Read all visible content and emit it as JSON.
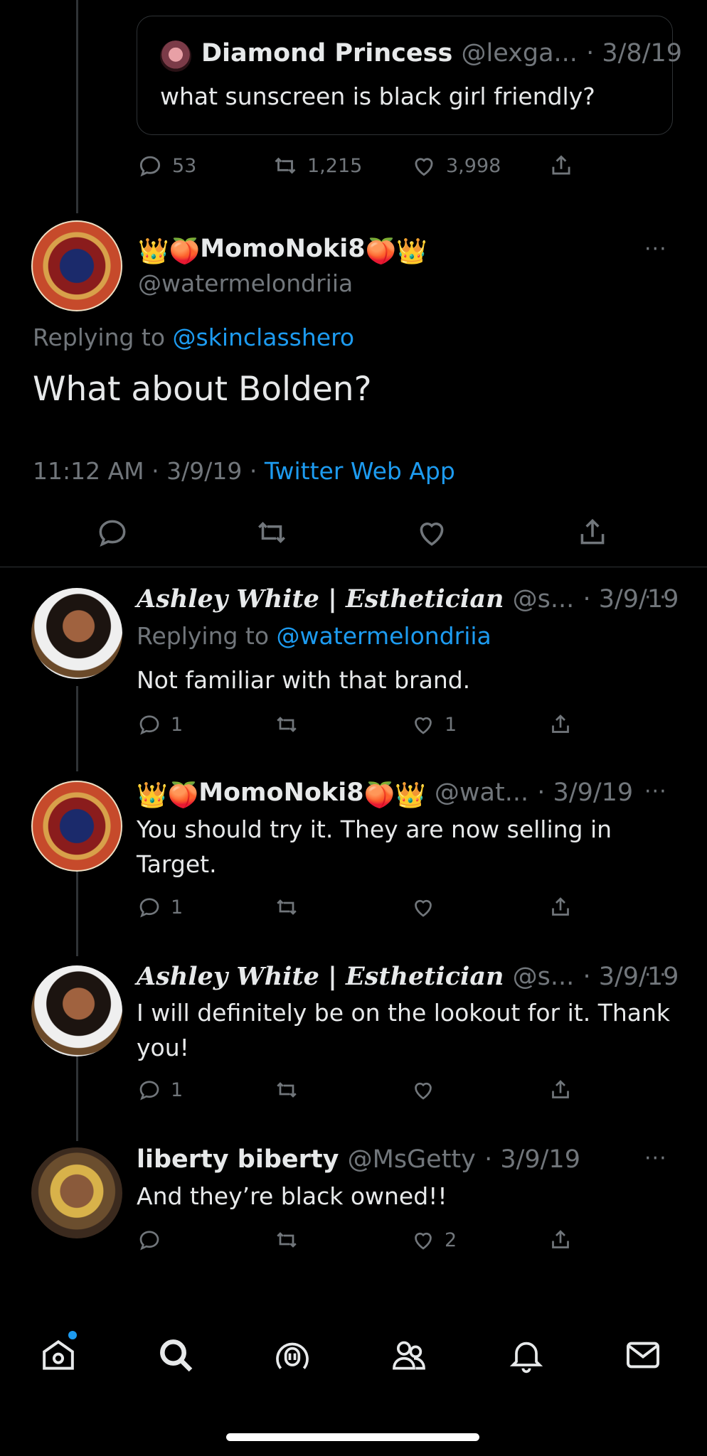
{
  "quoted_tweet": {
    "name": "Diamond Princess",
    "handle": "@lexga...",
    "date": "· 3/8/19",
    "text": "what sunscreen is black girl friendly?",
    "replies": "53",
    "retweets": "1,215",
    "likes": "3,998"
  },
  "main_tweet": {
    "display_name": "MomoNoki8",
    "handle": "@watermelondriia",
    "replying_prefix": "Replying to",
    "replying_to": "@skinclasshero",
    "text": "What about Bolden?",
    "time": "11:12 AM · 3/9/19 ·",
    "source": "Twitter Web App"
  },
  "replies": [
    {
      "name": "Ashley White | Esthetician",
      "handle": "@s...",
      "date": "· 3/9/19",
      "replying_prefix": "Replying to",
      "replying_to": "@watermelondriia",
      "text": "Not familiar with that brand.",
      "reply_count": "1",
      "like_count": "1"
    },
    {
      "name": "MomoNoki8",
      "handle": "@wat...",
      "date": "· 3/9/19",
      "text_line1": "You should try it. They are now selling in",
      "text_line2": "Target.",
      "reply_count": "1"
    },
    {
      "name": "Ashley White | Esthetician",
      "handle": "@s...",
      "date": "· 3/9/19",
      "text_line1": "I will definitely be on the lookout for it. Thank",
      "text_line2": "you!",
      "reply_count": "1"
    },
    {
      "name": "liberty biberty",
      "handle": "@MsGetty",
      "date": "· 3/9/19",
      "text": "And they’re black owned!!",
      "like_count": "2"
    }
  ],
  "more_label": "···",
  "icons": [
    "reply-icon",
    "retweet-icon",
    "like-icon",
    "share-icon",
    "home-icon",
    "search-icon",
    "spaces-icon",
    "communities-icon",
    "notifications-icon",
    "messages-icon"
  ],
  "colors": {
    "background": "#000000",
    "accent": "#1d9bf0",
    "muted": "#71767b",
    "text": "#e7e9ea"
  }
}
